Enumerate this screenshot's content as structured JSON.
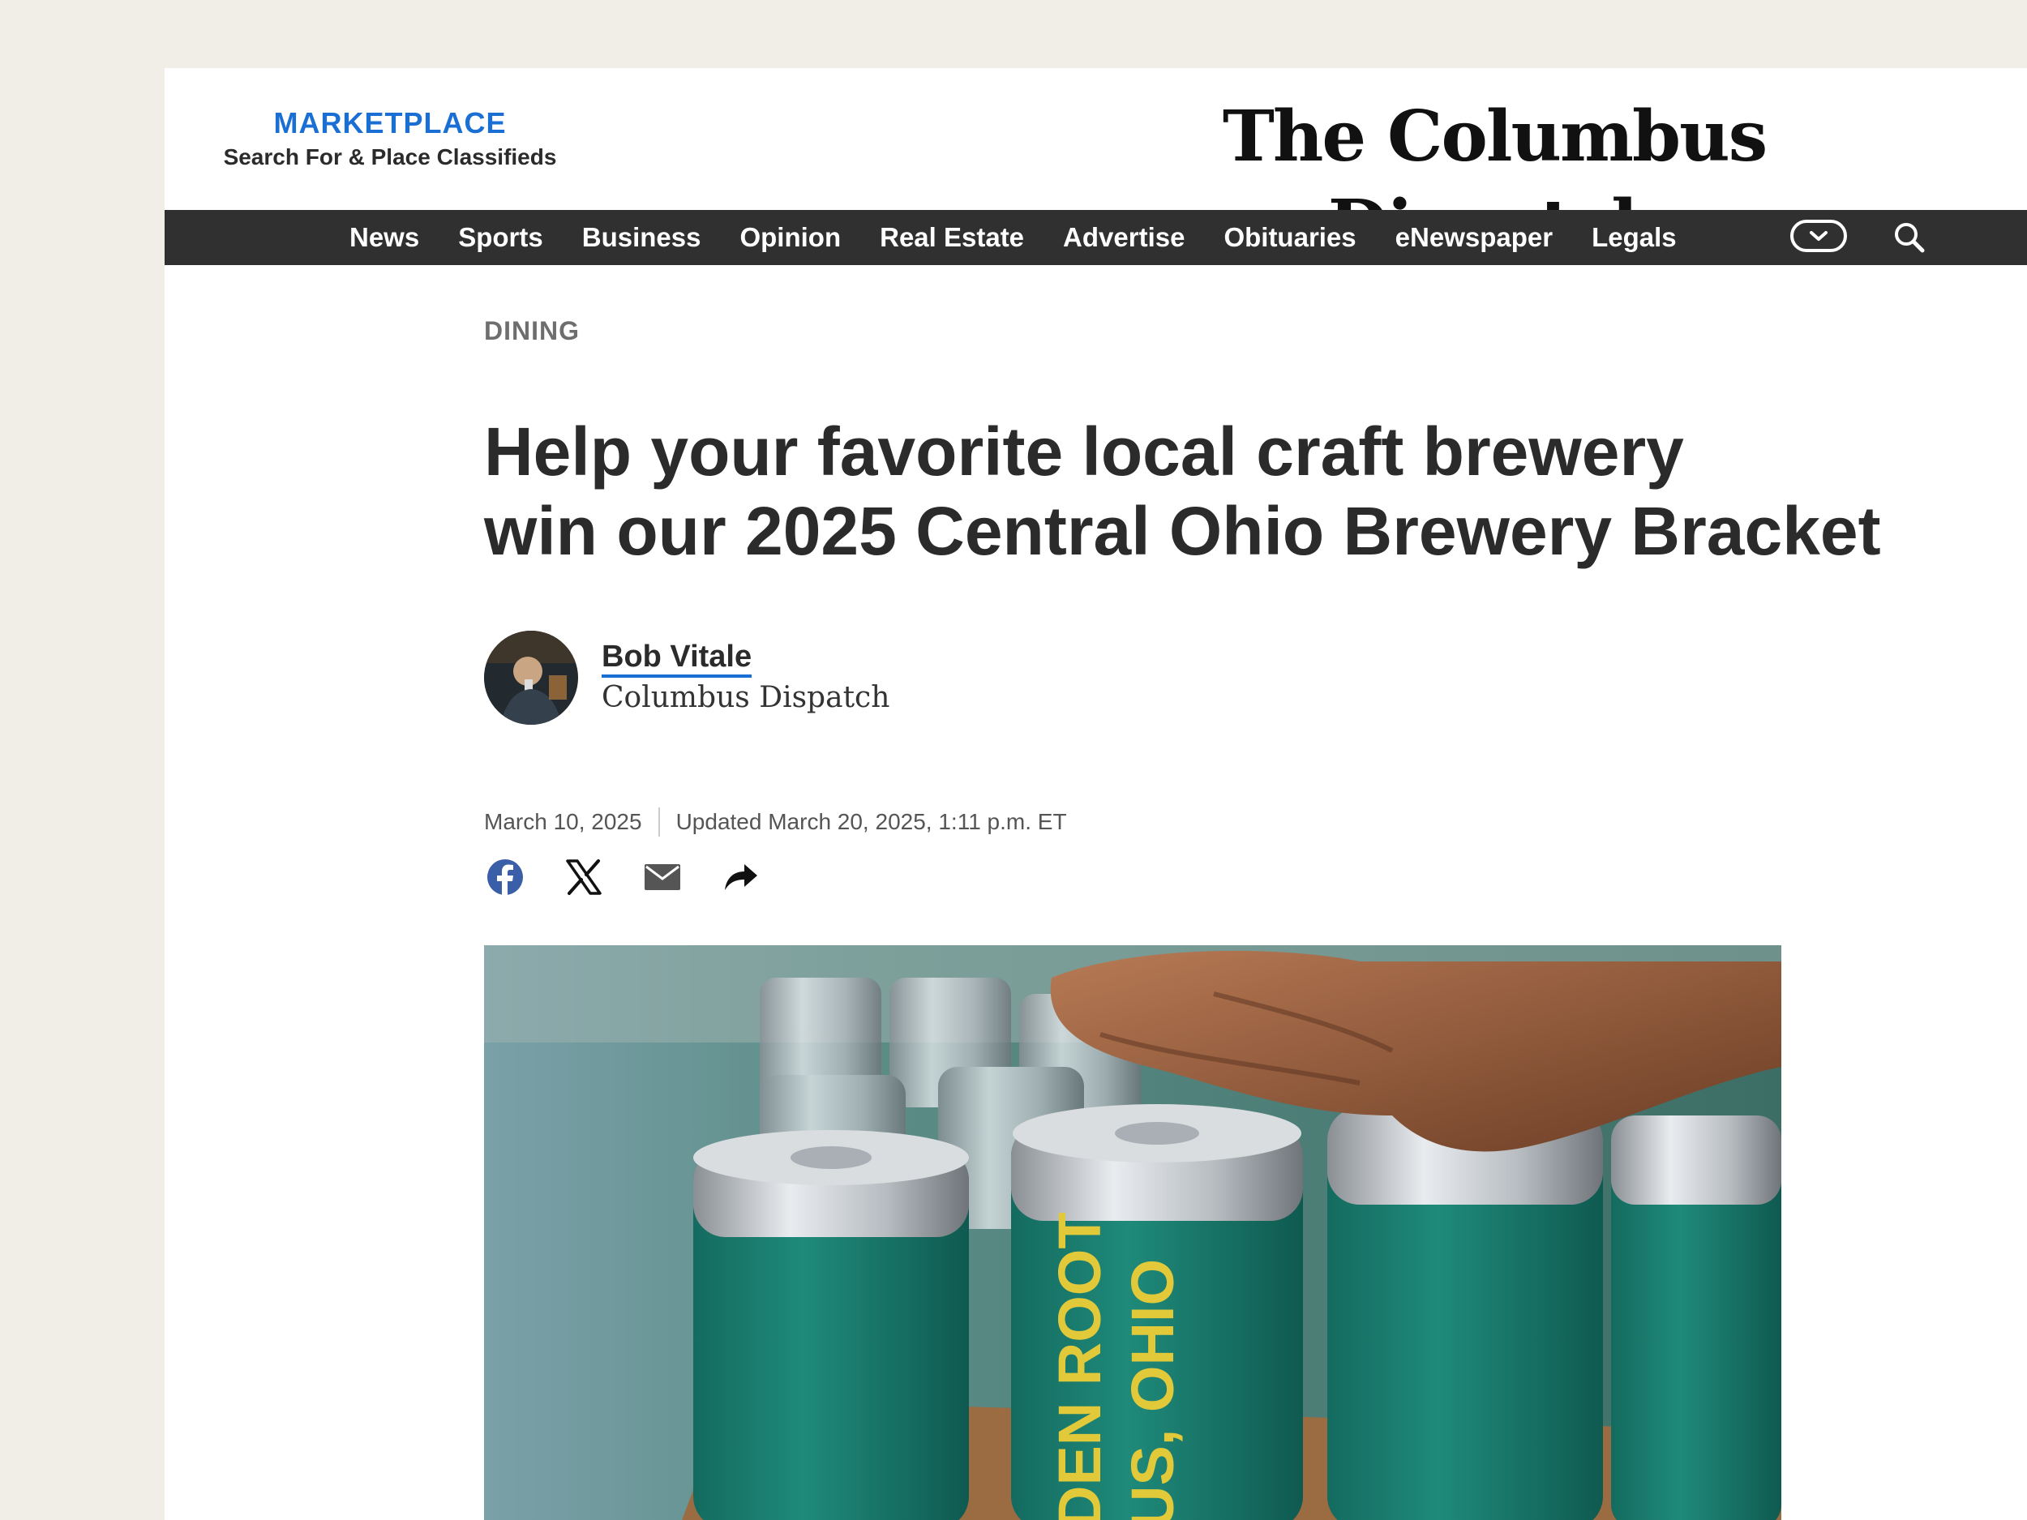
{
  "header": {
    "marketplace_title": "MARKETPLACE",
    "marketplace_subtitle": "Search For & Place Classifieds",
    "masthead": "The Columbus Dispatch"
  },
  "nav": {
    "items": [
      "News",
      "Sports",
      "Business",
      "Opinion",
      "Real Estate",
      "Advertise",
      "Obituaries",
      "eNewspaper",
      "Legals"
    ],
    "icons": [
      "chevron-down-icon",
      "search-icon"
    ]
  },
  "article": {
    "section": "DINING",
    "headline_line1": "Help your favorite local craft brewery",
    "headline_line2": "win our 2025 Central Ohio Brewery Bracket",
    "author": "Bob Vitale",
    "organization": "Columbus Dispatch",
    "published": "March 10, 2025",
    "updated": "Updated March 20, 2025, 1:11 p.m. ET",
    "share_icons": [
      "facebook-icon",
      "x-icon",
      "email-icon",
      "share-icon"
    ],
    "hero_can_text": [
      "DEN ROOT",
      "US, OHIO"
    ]
  },
  "colors": {
    "accent": "#1a6fd4",
    "nav_bg": "#303030",
    "page_bg": "#f1eee8",
    "can_green": "#1f8a7a",
    "can_text": "#e2c93a"
  }
}
